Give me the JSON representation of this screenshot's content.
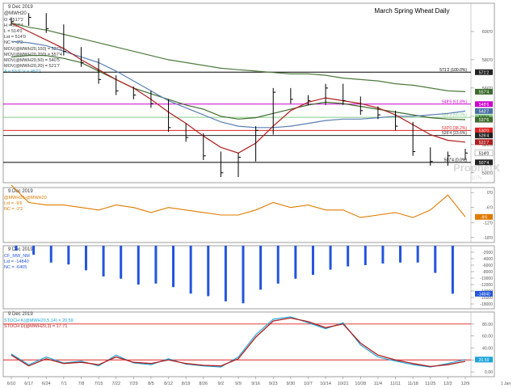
{
  "price_panel": {
    "date": "9 Dec 2019",
    "symbol": "@MWH20",
    "ohlc": {
      "open": "O = 517'2",
      "high": "H = 517'4",
      "low": "L = 514'0",
      "last": "Lst = 514'0",
      "net": "NC = -2'2"
    },
    "title": "March Spring Wheat Daily",
    "watermark_main": "ProphetX",
    "watermark_sub": "DTN",
    "studies": [
      {
        "label": "MOV(@MWH20,100) = 537'6",
        "color": "#8a8a8a"
      },
      {
        "label": "MOV(@MWH20,200) = 557'4",
        "color": "#3d6b2e"
      },
      {
        "label": "MOV(@MWH20,50) = 540'5",
        "color": "#4a6fa5"
      },
      {
        "label": "MOV(@MWH20,20) = 521'7",
        "color": "#b01e1e"
      },
      {
        "label": "A = 53.5' V = 457'1",
        "color": "#1aa3d9"
      }
    ],
    "y_ticks": [
      600,
      580,
      560,
      540,
      520,
      500
    ],
    "ylim": [
      493,
      620
    ],
    "hlines": [
      {
        "value": 571.2,
        "label": "571'2 (100.0%)",
        "color": "#000000"
      },
      {
        "value": 548.6,
        "label": "548'6 (61.8%)",
        "color": "#cc00cc"
      },
      {
        "value": 539.3,
        "label": "539'3 (50.0%)",
        "color": "#88cc88"
      },
      {
        "value": 530.0,
        "label": "530'0 (38.2%)",
        "color": "#dd2222"
      },
      {
        "value": 526.4,
        "label": "526'4 (23.6%)",
        "color": "#222222"
      },
      {
        "value": 507.4,
        "label": "507'4 (0.0%)",
        "color": "#000000"
      }
    ],
    "right_labels": [
      {
        "value": 571.2,
        "text": "571'2",
        "bg": "#222222",
        "fg": "#ffffff"
      },
      {
        "value": 557.4,
        "text": "557'4",
        "bg": "#3d6b2e",
        "fg": "#ffffff"
      },
      {
        "value": 548.6,
        "text": "548'6",
        "bg": "#cc00cc",
        "fg": "#ffffff"
      },
      {
        "value": 543.7,
        "text": "543'7",
        "bg": "#4a6fa5",
        "fg": "#ffffff"
      },
      {
        "value": 539.3,
        "text": "539'3",
        "bg": "#88cc88",
        "fg": "#000000"
      },
      {
        "value": 537.6,
        "text": "537'6",
        "bg": "#3d6b2e",
        "fg": "#ffffff"
      },
      {
        "value": 530.0,
        "text": "530'0",
        "bg": "#dd2222",
        "fg": "#ffffff"
      },
      {
        "value": 526.4,
        "text": "526'4",
        "bg": "#222222",
        "fg": "#ffffff"
      },
      {
        "value": 521.7,
        "text": "521'7",
        "bg": "#b01e1e",
        "fg": "#ffffff"
      },
      {
        "value": 514.0,
        "text": "514'0",
        "bg": "#ffffff",
        "fg": "#000000"
      },
      {
        "value": 507.4,
        "text": "507'4",
        "bg": "#222222",
        "fg": "#ffffff"
      }
    ]
  },
  "spread_panel": {
    "date": "9 Dec 2019",
    "legend": [
      "@MWH20-@MWH20",
      "Lst = -9'6",
      "NC = -2'2"
    ],
    "color": "#e07b00",
    "y_ticks": [
      "0'0",
      "-6'0",
      "-12'0",
      "-18'0"
    ],
    "ylim": [
      -20,
      2
    ],
    "last_label": "-9'6"
  },
  "cot_panel": {
    "date": "9 Dec 2019",
    "legend": [
      "CF_MW_NM",
      "Lst = -14840",
      "NC = -6405"
    ],
    "color": "#2255dd",
    "y_ticks": [
      "-2000",
      "-4000",
      "-6000",
      "-8000",
      "-10000",
      "-12000",
      "-14000",
      "-16000",
      "-18000"
    ],
    "ylim": [
      -19500,
      0
    ],
    "last_label": "-14840"
  },
  "stoch_panel": {
    "date": "9 Dec 2019",
    "legend": [
      {
        "label": "STOCH K(@MWH20,5,14) = 20.59",
        "color": "#1aa3d9"
      },
      {
        "label": "STOCH D(@MWH20,3) = 17.71",
        "color": "#b01e1e"
      }
    ],
    "y_ticks": [
      "80.00",
      "60.00",
      "40.00",
      "20.00",
      "0.00"
    ],
    "ylim": [
      -8,
      100
    ],
    "overbought": 80,
    "oversold": 20,
    "last_label": "20.59"
  },
  "x_axis": {
    "labels": [
      "6/10",
      "6/17",
      "6/24",
      "7/1",
      "7/8",
      "7/15",
      "7/22",
      "7/29",
      "8/5",
      "8/12",
      "8/19",
      "8/26",
      "9/2",
      "9/9",
      "9/16",
      "9/23",
      "9/30",
      "10/7",
      "10/14",
      "10/21",
      "10/28",
      "11/4",
      "11/11",
      "11/18",
      "11/25",
      "12/2",
      "12/9"
    ],
    "far_right": "1 Jan"
  },
  "chart_data": [
    {
      "type": "line",
      "title": "March Spring Wheat Daily",
      "x": [
        "2019-06-10",
        "2019-06-17",
        "2019-06-24",
        "2019-07-01",
        "2019-07-08",
        "2019-07-15",
        "2019-07-22",
        "2019-07-29",
        "2019-08-05",
        "2019-08-12",
        "2019-08-19",
        "2019-08-26",
        "2019-09-02",
        "2019-09-09",
        "2019-09-16",
        "2019-09-23",
        "2019-09-30",
        "2019-10-07",
        "2019-10-14",
        "2019-10-21",
        "2019-10-28",
        "2019-11-04",
        "2019-11-11",
        "2019-11-18",
        "2019-11-25",
        "2019-12-02",
        "2019-12-09"
      ],
      "series": [
        {
          "name": "@MWH20",
          "values": [
            607,
            610,
            602,
            586,
            578,
            566,
            558,
            555,
            549,
            532,
            525,
            512,
            500,
            511,
            530,
            557,
            552,
            551,
            560,
            551,
            544,
            541,
            533,
            515,
            508,
            512,
            514
          ]
        },
        {
          "name": "MOV(@MWH20,200)",
          "values": [
            606,
            603,
            601,
            598,
            595,
            592,
            589,
            586,
            583,
            580,
            578,
            576,
            574,
            573,
            572,
            571,
            570,
            570,
            569,
            567,
            566,
            565,
            563,
            562,
            560,
            558,
            557.4
          ]
        },
        {
          "name": "MOV(@MWH20,100)",
          "values": [
            582,
            583,
            583,
            581,
            578,
            572,
            566,
            560,
            556,
            552,
            548,
            545,
            540,
            538,
            539,
            542,
            545,
            548,
            550,
            549,
            547,
            545,
            543,
            541,
            539,
            538,
            537.6
          ]
        },
        {
          "name": "MOV(@MWH20,50)",
          "values": [
            593,
            592,
            590,
            586,
            582,
            578,
            572,
            565,
            558,
            551,
            546,
            541,
            536,
            533,
            532,
            532,
            533,
            535,
            537,
            538,
            538,
            539,
            540,
            540,
            541,
            542,
            543.7
          ]
        },
        {
          "name": "MOV(@MWH20,20)",
          "values": [
            606,
            600,
            594,
            588,
            580,
            573,
            566,
            560,
            552,
            543,
            535,
            526,
            518,
            514,
            521,
            533,
            544,
            550,
            553,
            551,
            549,
            546,
            541,
            534,
            527,
            523,
            521.7
          ]
        }
      ]
    },
    {
      "type": "line",
      "series": [
        {
          "name": "@MWH20-@MWH20",
          "values": [
            3,
            -4,
            -5,
            -5,
            -6,
            -7,
            -5,
            -6,
            -8,
            -6,
            -7,
            -8,
            -9,
            -9,
            -7,
            -4,
            -6,
            -5,
            -7,
            -7,
            -10,
            -9,
            -8,
            -10,
            -7,
            -1,
            -9.75
          ]
        }
      ],
      "ylim": [
        -20,
        2
      ]
    },
    {
      "type": "bar",
      "series": [
        {
          "name": "CF_MW_NM",
          "values": [
            -1500,
            -2800,
            -5200,
            -5800,
            -7600,
            -9500,
            -10200,
            -12000,
            -11700,
            -12800,
            -14800,
            -15600,
            -17200,
            -17800,
            -13600,
            -11700,
            -10200,
            -9000,
            -7400,
            -6400,
            -6000,
            -5500,
            -5200,
            -5200,
            -8400,
            -14840
          ]
        }
      ],
      "ylim": [
        -19500,
        0
      ]
    },
    {
      "type": "line",
      "series": [
        {
          "name": "STOCH K(@MWH20,5,14)",
          "values": [
            30,
            12,
            25,
            15,
            18,
            10,
            28,
            15,
            12,
            22,
            13,
            10,
            8,
            25,
            62,
            88,
            92,
            82,
            72,
            82,
            45,
            25,
            18,
            12,
            8,
            14,
            20.59
          ]
        },
        {
          "name": "STOCH D(@MWH20,3)",
          "values": [
            28,
            10,
            22,
            14,
            16,
            12,
            25,
            16,
            14,
            20,
            14,
            11,
            10,
            22,
            58,
            85,
            90,
            84,
            74,
            80,
            48,
            28,
            20,
            14,
            9,
            12,
            17.71
          ]
        }
      ],
      "ylim": [
        -8,
        100
      ]
    }
  ]
}
